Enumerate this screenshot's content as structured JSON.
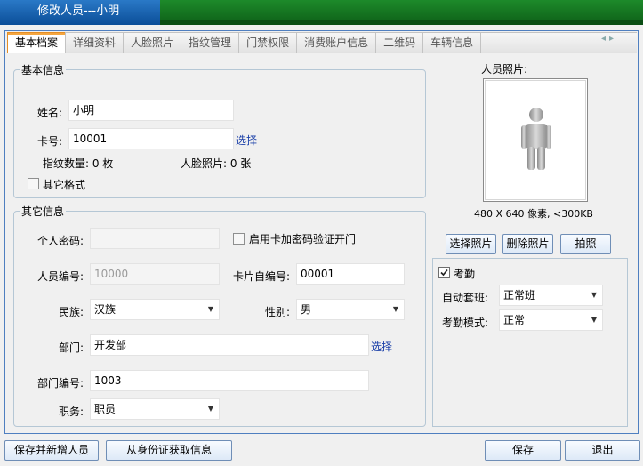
{
  "window": {
    "title": "修改人员---小明"
  },
  "tabs": [
    {
      "label": "基本档案"
    },
    {
      "label": "详细资料"
    },
    {
      "label": "人脸照片"
    },
    {
      "label": "指纹管理"
    },
    {
      "label": "门禁权限"
    },
    {
      "label": "消费账户信息"
    },
    {
      "label": "二维码"
    },
    {
      "label": "车辆信息"
    }
  ],
  "basic": {
    "legend": "基本信息",
    "name_label": "姓名:",
    "name_value": "小明",
    "card_label": "卡号:",
    "card_value": "10001",
    "card_select": "选择",
    "fingerprint_text": "指纹数量: 0 枚",
    "face_text": "人脸照片: 0 张",
    "other_format": "其它格式"
  },
  "other": {
    "legend": "其它信息",
    "password_label": "个人密码:",
    "password_value": "",
    "card_pwd_check": "启用卡加密码验证开门",
    "person_no_label": "人员编号:",
    "person_no_value": "10000",
    "card_self_no_label": "卡片自编号:",
    "card_self_no_value": "00001",
    "ethnic_label": "民族:",
    "ethnic_value": "汉族",
    "gender_label": "性别:",
    "gender_value": "男",
    "dept_label": "部门:",
    "dept_value": "开发部",
    "dept_select": "选择",
    "dept_no_label": "部门编号:",
    "dept_no_value": "1003",
    "job_label": "职务:",
    "job_value": "职员"
  },
  "photo": {
    "label": "人员照片:",
    "hint": "480 X 640 像素, <300KB",
    "select_btn": "选择照片",
    "delete_btn": "删除照片",
    "capture_btn": "拍照"
  },
  "attendance": {
    "check_label": "考勤",
    "checked": true,
    "auto_shift_label": "自动套班:",
    "auto_shift_value": "正常班",
    "mode_label": "考勤模式:",
    "mode_value": "正常"
  },
  "footer": {
    "save_add": "保存并新增人员",
    "from_id": "从身份证获取信息",
    "save": "保存",
    "exit": "退出"
  }
}
